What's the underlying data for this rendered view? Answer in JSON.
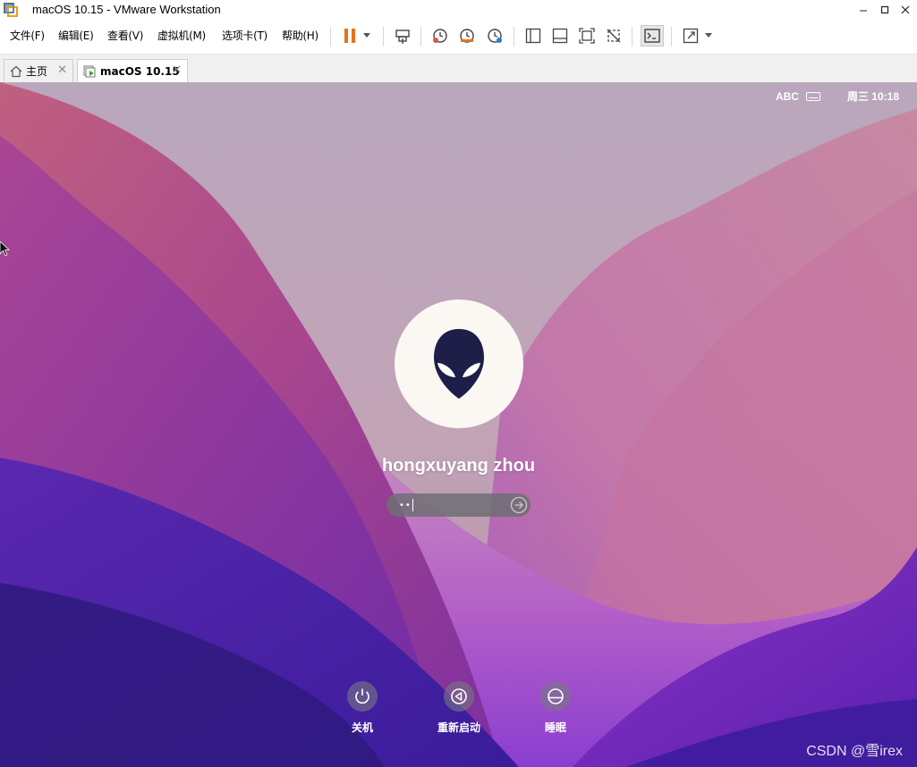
{
  "window": {
    "title": "macOS 10.15 - VMware Workstation",
    "icon": "vmware-icon",
    "controls": [
      "minimize-icon",
      "maximize-icon",
      "close-icon"
    ]
  },
  "menu": {
    "items": [
      {
        "label": "文件(F)"
      },
      {
        "label": "编辑(E)"
      },
      {
        "label": "查看(V)"
      },
      {
        "label": "虚拟机(M)"
      },
      {
        "label": "选项卡(T)"
      },
      {
        "label": "帮助(H)"
      }
    ]
  },
  "toolbar": {
    "accent": "#e8711c",
    "icons": [
      "pause-icon",
      "dropdown-icon",
      "send-keys-icon",
      "snapshot-icon",
      "revert-snapshot-icon",
      "snapshot-manager-icon",
      "library-icon",
      "thumbnail-bar-icon",
      "fullscreen-icon",
      "unity-icon",
      "console-icon",
      "stretch-icon",
      "dropdown-icon"
    ]
  },
  "tabs": [
    {
      "label": "主页",
      "icon": "home-icon",
      "active": false
    },
    {
      "label": "macOS 10.15",
      "icon": "vm-running-icon",
      "active": true
    }
  ],
  "vm": {
    "status": {
      "input_source": "ABC",
      "datetime": "周三 10:18"
    },
    "user": {
      "name": "hongxuyang zhou",
      "avatar": "alien-avatar-icon"
    },
    "password": {
      "masked_value": "••"
    },
    "power_options": [
      {
        "label": "关机",
        "icon": "shutdown-icon"
      },
      {
        "label": "重新启动",
        "icon": "restart-icon"
      },
      {
        "label": "睡眠",
        "icon": "sleep-icon"
      }
    ]
  },
  "watermark": "CSDN @雪irex"
}
